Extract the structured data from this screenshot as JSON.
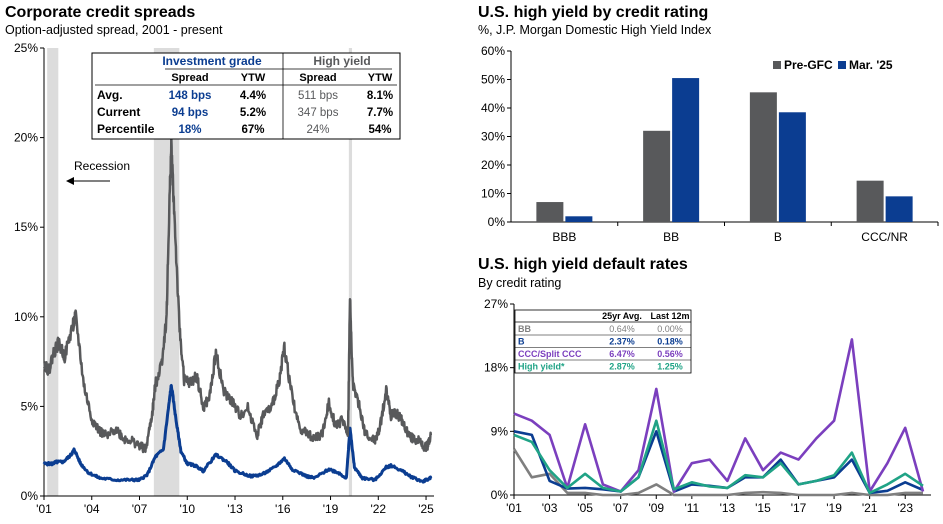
{
  "chart_data": [
    {
      "type": "line",
      "title": "Corporate credit spreads",
      "subtitle": "Option-adjusted spread, 2001 - present",
      "x_ticks": [
        "'01",
        "'04",
        "'07",
        "'10",
        "'13",
        "'16",
        "'19",
        "'22",
        "'25"
      ],
      "y_ticks": [
        "0%",
        "5%",
        "10%",
        "15%",
        "20%",
        "25%"
      ],
      "ylim": [
        0,
        25
      ],
      "recession_label": "Recession",
      "recessions": [
        [
          2001.2,
          2001.9
        ],
        [
          2007.9,
          2009.5
        ],
        [
          2020.15,
          2020.35
        ]
      ],
      "colors": {
        "investment_grade": "#0b3d91",
        "high_yield": "#58595b",
        "recession": "#dcdcdc"
      },
      "series": [
        {
          "name": "Investment grade",
          "x": [
            2001.0,
            2001.5,
            2001.8,
            2002.2,
            2002.7,
            2002.9,
            2003.3,
            2003.8,
            2004.5,
            2005.5,
            2006.5,
            2007.0,
            2007.5,
            2008.0,
            2008.5,
            2008.9,
            2009.0,
            2009.3,
            2009.6,
            2010.0,
            2010.5,
            2011.0,
            2011.8,
            2012.5,
            2013.0,
            2014.0,
            2014.7,
            2015.5,
            2016.1,
            2016.6,
            2017.5,
            2018.0,
            2018.9,
            2019.5,
            2020.0,
            2020.22,
            2020.5,
            2021.0,
            2021.8,
            2022.5,
            2022.8,
            2023.5,
            2024.0,
            2024.8,
            2025.0,
            2025.3
          ],
          "values": [
            1.8,
            1.8,
            1.9,
            1.9,
            2.3,
            2.6,
            1.8,
            1.3,
            1.0,
            0.9,
            0.9,
            0.9,
            1.2,
            2.2,
            2.6,
            5.5,
            6.2,
            4.2,
            2.5,
            1.8,
            1.7,
            1.4,
            2.3,
            1.9,
            1.4,
            1.1,
            1.2,
            1.6,
            2.1,
            1.5,
            1.1,
            1.0,
            1.5,
            1.3,
            1.0,
            3.8,
            1.6,
            1.0,
            0.9,
            1.6,
            1.7,
            1.4,
            1.1,
            0.8,
            0.9,
            1.0
          ]
        },
        {
          "name": "High yield",
          "x": [
            2001.0,
            2001.3,
            2001.6,
            2001.9,
            2002.3,
            2002.8,
            2003.0,
            2003.5,
            2004.0,
            2004.5,
            2005.0,
            2005.5,
            2006.0,
            2006.5,
            2007.0,
            2007.4,
            2007.8,
            2008.0,
            2008.4,
            2008.7,
            2008.9,
            2009.0,
            2009.2,
            2009.5,
            2009.8,
            2010.2,
            2010.6,
            2011.0,
            2011.4,
            2011.8,
            2012.3,
            2012.8,
            2013.3,
            2013.8,
            2014.4,
            2014.8,
            2015.3,
            2015.8,
            2016.1,
            2016.5,
            2017.0,
            2017.5,
            2018.0,
            2018.5,
            2018.9,
            2019.3,
            2019.8,
            2020.1,
            2020.22,
            2020.4,
            2020.8,
            2021.2,
            2021.8,
            2022.1,
            2022.5,
            2022.8,
            2023.2,
            2023.6,
            2024.0,
            2024.5,
            2024.9,
            2025.1,
            2025.3
          ],
          "values": [
            7.5,
            7.0,
            8.0,
            8.5,
            7.8,
            9.5,
            10.0,
            6.2,
            4.3,
            3.6,
            3.3,
            3.8,
            3.2,
            3.1,
            2.8,
            2.6,
            4.6,
            6.2,
            7.5,
            10.0,
            17.0,
            19.5,
            15.5,
            9.5,
            6.5,
            6.3,
            6.7,
            4.9,
            5.5,
            8.0,
            5.8,
            5.3,
            4.5,
            4.9,
            3.4,
            4.6,
            4.9,
            6.6,
            8.3,
            6.0,
            3.9,
            3.5,
            3.2,
            3.5,
            5.2,
            4.0,
            4.2,
            3.5,
            10.9,
            6.3,
            5.0,
            3.4,
            3.1,
            3.8,
            5.9,
            4.5,
            4.6,
            4.0,
            3.3,
            3.1,
            2.7,
            2.8,
            3.4
          ]
        }
      ],
      "table": {
        "group_headers": [
          "Investment grade",
          "High yield"
        ],
        "col_headers": [
          "Spread",
          "YTW",
          "Spread",
          "YTW"
        ],
        "rows": [
          {
            "label": "Avg.",
            "cells": [
              "148 bps",
              "4.4%",
              "511 bps",
              "8.1%"
            ]
          },
          {
            "label": "Current",
            "cells": [
              "94 bps",
              "5.2%",
              "347 bps",
              "7.7%"
            ]
          },
          {
            "label": "Percentile",
            "cells": [
              "18%",
              "67%",
              "24%",
              "54%"
            ]
          }
        ]
      }
    },
    {
      "type": "bar",
      "title": "U.S. high yield by credit rating",
      "subtitle": "%, J.P. Morgan Domestic High Yield Index",
      "categories": [
        "BBB",
        "BB",
        "B",
        "CCC/NR"
      ],
      "y_ticks": [
        "0%",
        "10%",
        "20%",
        "30%",
        "40%",
        "50%",
        "60%"
      ],
      "ylim": [
        0,
        60
      ],
      "legend_position": "top-right",
      "series": [
        {
          "name": "Pre-GFC",
          "color": "#58595b",
          "values": [
            7,
            32,
            45.5,
            14.5
          ]
        },
        {
          "name": "Mar. '25",
          "color": "#0b3d91",
          "values": [
            2,
            50.5,
            38.5,
            9
          ]
        }
      ]
    },
    {
      "type": "line",
      "title": "U.S. high yield default rates",
      "subtitle": "By credit rating",
      "x": [
        2001,
        2002,
        2003,
        2004,
        2005,
        2006,
        2007,
        2008,
        2009,
        2010,
        2011,
        2012,
        2013,
        2014,
        2015,
        2016,
        2017,
        2018,
        2019,
        2020,
        2021,
        2022,
        2023,
        2024
      ],
      "x_ticks": [
        "'01",
        "'03",
        "'05",
        "'07",
        "'09",
        "'11",
        "'13",
        "'15",
        "'17",
        "'19",
        "'21",
        "'23"
      ],
      "y_ticks": [
        "0%",
        "9%",
        "18%",
        "27%"
      ],
      "ylim": [
        0,
        27
      ],
      "series": [
        {
          "name": "BB",
          "color": "#7f7f7f",
          "values": [
            6.5,
            2.5,
            3.0,
            0.3,
            0.3,
            0.0,
            0.0,
            0.3,
            1.5,
            0.0,
            0.0,
            0.0,
            0.0,
            0.3,
            0.4,
            0.3,
            0.0,
            0.0,
            0.0,
            0.3,
            0.0,
            0.0,
            0.3,
            0.3
          ]
        },
        {
          "name": "B",
          "color": "#0b3d91",
          "values": [
            9.0,
            8.5,
            2.0,
            0.9,
            1.0,
            0.8,
            0.5,
            2.5,
            9.0,
            0.5,
            1.5,
            1.3,
            1.0,
            2.5,
            2.5,
            5.0,
            1.5,
            2.0,
            2.5,
            5.0,
            0.3,
            0.6,
            1.8,
            0.7
          ]
        },
        {
          "name": "CCC/Split CCC",
          "color": "#7b3fbe",
          "values": [
            11.5,
            10.5,
            8.5,
            1.0,
            10.0,
            1.5,
            0.5,
            3.5,
            15.0,
            0.5,
            4.5,
            5.0,
            2.0,
            8.0,
            3.5,
            6.0,
            5.0,
            8.0,
            10.5,
            22.0,
            0.5,
            4.5,
            9.5,
            0.5
          ]
        },
        {
          "name": "High yield*",
          "color": "#20a386",
          "values": [
            8.5,
            7.5,
            3.5,
            1.0,
            3.0,
            1.0,
            0.5,
            2.5,
            10.5,
            0.8,
            1.8,
            1.2,
            1.0,
            2.8,
            2.5,
            4.5,
            1.5,
            2.0,
            2.8,
            6.0,
            0.3,
            1.5,
            3.0,
            1.3
          ]
        }
      ],
      "table": {
        "col_headers": [
          "25yr Avg.",
          "Last 12m"
        ],
        "rows": [
          {
            "label": "BB",
            "cells": [
              "0.64%",
              "0.00%"
            ]
          },
          {
            "label": "B",
            "cells": [
              "2.37%",
              "0.18%"
            ]
          },
          {
            "label": "CCC/Split CCC",
            "cells": [
              "6.47%",
              "0.56%"
            ]
          },
          {
            "label": "High yield*",
            "cells": [
              "2.87%",
              "1.25%"
            ]
          }
        ]
      }
    }
  ]
}
